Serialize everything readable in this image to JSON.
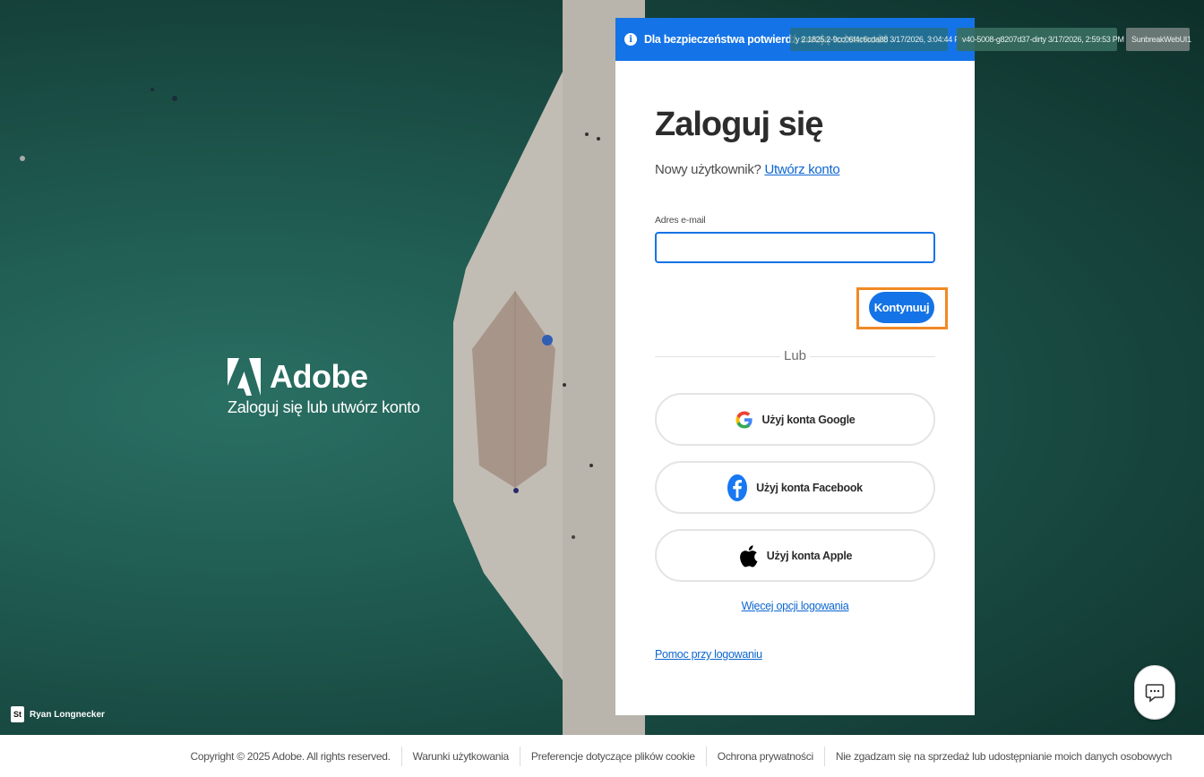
{
  "brand": {
    "name": "Adobe",
    "tagline": "Zaloguj się lub utwórz konto"
  },
  "credit": {
    "logo_text": "St",
    "photographer": "Ryan Longnecker"
  },
  "badges": {
    "a": "y 2.1825.2-9cc06f4c6cda88 3/17/2026, 3:04:44 PM",
    "b": "v40-5008-g8207d37-dirty 3/17/2026, 2:59:53 PM",
    "c": "SunbreakWebUI1"
  },
  "card": {
    "notice": "Dla bezpieczeństwa potwierdź swoją tożsamość",
    "title": "Zaloguj się",
    "new_user_prefix": "Nowy użytkownik?",
    "create_account": "Utwórz konto",
    "email_label": "Adres e-mail",
    "email_value": "",
    "continue": "Kontynuuj",
    "or": "Lub",
    "google": "Użyj konta Google",
    "facebook": "Użyj konta Facebook",
    "apple": "Użyj konta Apple",
    "more_options": "Więcej opcji logowania",
    "help": "Pomoc przy logowaniu"
  },
  "footer": {
    "copyright": "Copyright © 2025 Adobe. All rights reserved.",
    "terms": "Warunki użytkowania",
    "cookies": "Preferencje dotyczące plików cookie",
    "privacy": "Ochrona prywatności",
    "do_not_sell": "Nie zgadzam się na sprzedaż lub udostępnianie moich danych osobowych"
  },
  "colors": {
    "accent": "#1473e6",
    "focus": "#f08a24",
    "link": "#0d66d0"
  }
}
